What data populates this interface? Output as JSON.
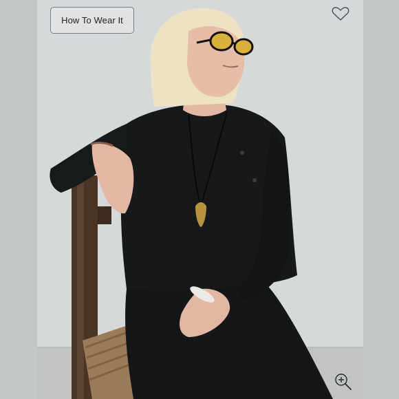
{
  "product_viewer": {
    "how_to_wear_label": "How To Wear It",
    "favorite_icon": "heart-outline-icon",
    "zoom_icon": "zoom-in-icon"
  },
  "photo": {
    "subject": "model-seated-on-wooden-chair",
    "colors": {
      "background_wall": "#d4d7d8",
      "garment": "#141617",
      "hair": "#eee2c4",
      "skin": "#e2b8a4",
      "chair_wood": "#4a3424",
      "chair_seat": "#9c7c58",
      "pendant": "#b8933e"
    }
  }
}
